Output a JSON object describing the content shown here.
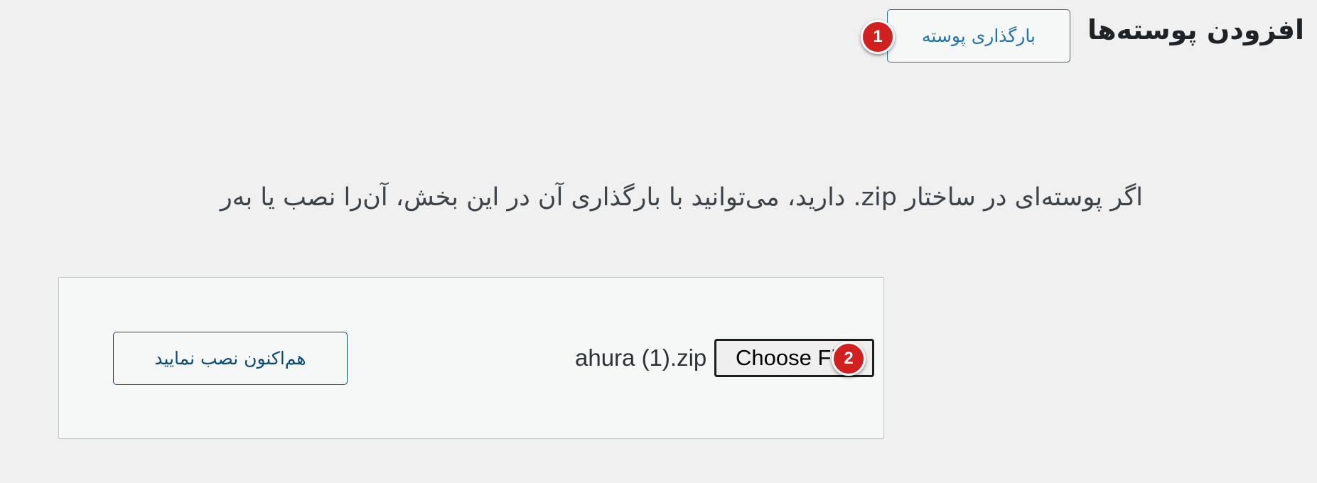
{
  "header": {
    "title": "افزودن پوسته‌ها",
    "upload_theme_button": "بارگذاری پوسته"
  },
  "markers": {
    "first": "1",
    "second": "2"
  },
  "upload_section": {
    "description": "اگر پوسته‌ای در ساختار zip. دارید، می‌توانید با بارگذاری آن در این بخش، آن‌را نصب یا به‌ر",
    "selected_file_name": "ahura (1).zip",
    "choose_file_label": "Choose File",
    "install_now_label": "هم‌اکنون نصب نمایید"
  },
  "colors": {
    "accent": "#2271b1",
    "install_button": "#0a4b78",
    "marker": "#d21f1f",
    "background": "#f0f0f1"
  }
}
